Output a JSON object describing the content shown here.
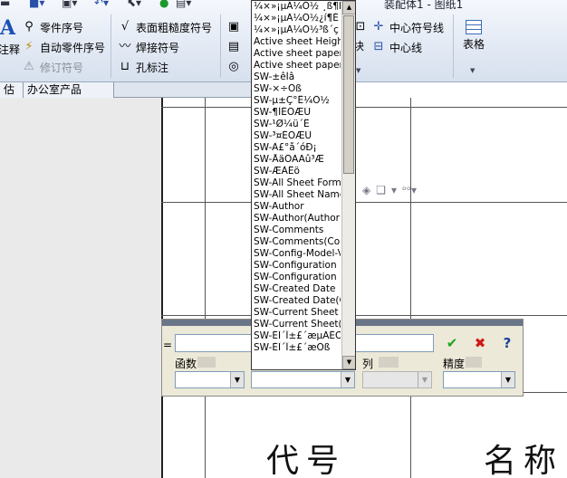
{
  "window": {
    "title_fragment": "装配体1 - 图纸1"
  },
  "ribbon": {
    "annotation_big_label": "注释",
    "part_number": "零件序号",
    "auto_part_number": "自动零件序号",
    "revision_symbol": "修订符号",
    "surface_finish": "表面粗糙度符号",
    "weld_symbol": "焊接符号",
    "hole_callout": "孔标注",
    "center_mark": "中心符号线",
    "centerline": "中心线",
    "block_label": "块",
    "table_label": "表格"
  },
  "tabs": [
    {
      "label": "估"
    },
    {
      "label": "办公室产品"
    }
  ],
  "dropdown": {
    "items": [
      "¼×»¡µÄ¼Ö½ ¸ß¶È",
      "¼×»¡µÄ¼Ö½¿í¶È",
      "¼×»¡µÄ¼Ö½³ß´ç",
      "Active sheet Height",
      "Active sheet paper size",
      "Active sheet paper width",
      "SW-±êÌâ",
      "SW-×÷Õß",
      "SW-µ±Ç°Ê¼Ö½",
      "SW-¶ÌÈÕÆÚ",
      "SW-¹Ø¼ü´Ê",
      "SW-³¤ÈÕÆÚ",
      "SW-Ä£°å´óÐ¡",
      "SW-ÅäÖÃÃû³Æ",
      "SW-ÆÀÊö",
      "SW-All Sheet Formats",
      "SW-All Sheet Names",
      "SW-Author",
      "SW-Author(Author)",
      "SW-Comments",
      "SW-Comments(Comments)",
      "SW-Config-Model-View",
      "SW-Configuration Name",
      "SW-Configuration Name",
      "SW-Created Date",
      "SW-Created Date(Created)",
      "SW-Current Sheet",
      "SW-Current Sheet(Current)",
      "SW-ÉÏ´Î±£´æµÄÈÕÆÚ",
      "SW-ÉÏ´Î±£´æÕß"
    ]
  },
  "formula_bar": {
    "equals": "=",
    "functions_label": "函数",
    "column_label": "列",
    "precision_label": "精度",
    "accept_glyph": "✔",
    "cancel_glyph": "✖",
    "help_glyph": "?"
  },
  "sheet_table": {
    "col1_header": "代号",
    "col2_header": "名称"
  },
  "colors": {
    "ribbon_bg": "#e2e9f4",
    "accept": "#1aa51a",
    "cancel": "#d01818",
    "help": "#1b3f9a"
  }
}
